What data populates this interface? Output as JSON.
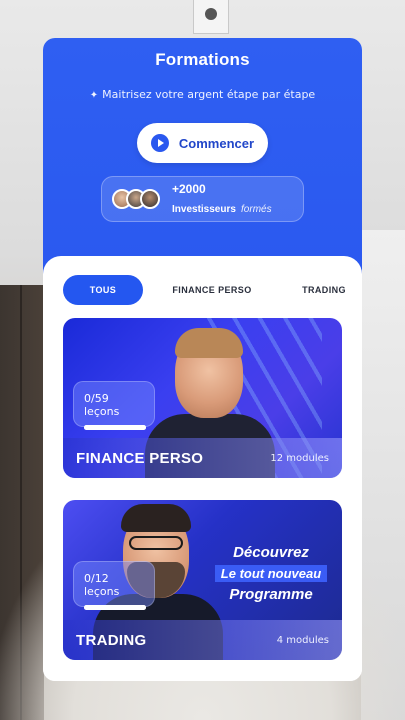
{
  "header": {
    "title": "Formations",
    "subtitle": "Maitrisez votre argent étape par étape",
    "start_button": "Commencer",
    "investors_count": "+2000",
    "investors_label": "Investisseurs",
    "investors_label_italic": "formés"
  },
  "tabs": [
    {
      "label": "TOUS",
      "active": true
    },
    {
      "label": "FINANCE PERSO",
      "active": false
    },
    {
      "label": "TRADING",
      "active": false
    }
  ],
  "courses": [
    {
      "name": "FINANCE PERSO",
      "modules": "12 modules",
      "progress_count": "0/59",
      "progress_unit": "leçons",
      "progress_fraction": 0
    },
    {
      "name": "TRADING",
      "modules": "4 modules",
      "progress_count": "0/12",
      "progress_unit": "leçons",
      "progress_fraction": 0,
      "promo_line1": "Découvrez",
      "promo_line2": "Le tout nouveau",
      "promo_line3": "Programme"
    }
  ],
  "colors": {
    "primary": "#2a58ef",
    "tab_active": "#2457f0",
    "card_bg": "#ffffff"
  }
}
